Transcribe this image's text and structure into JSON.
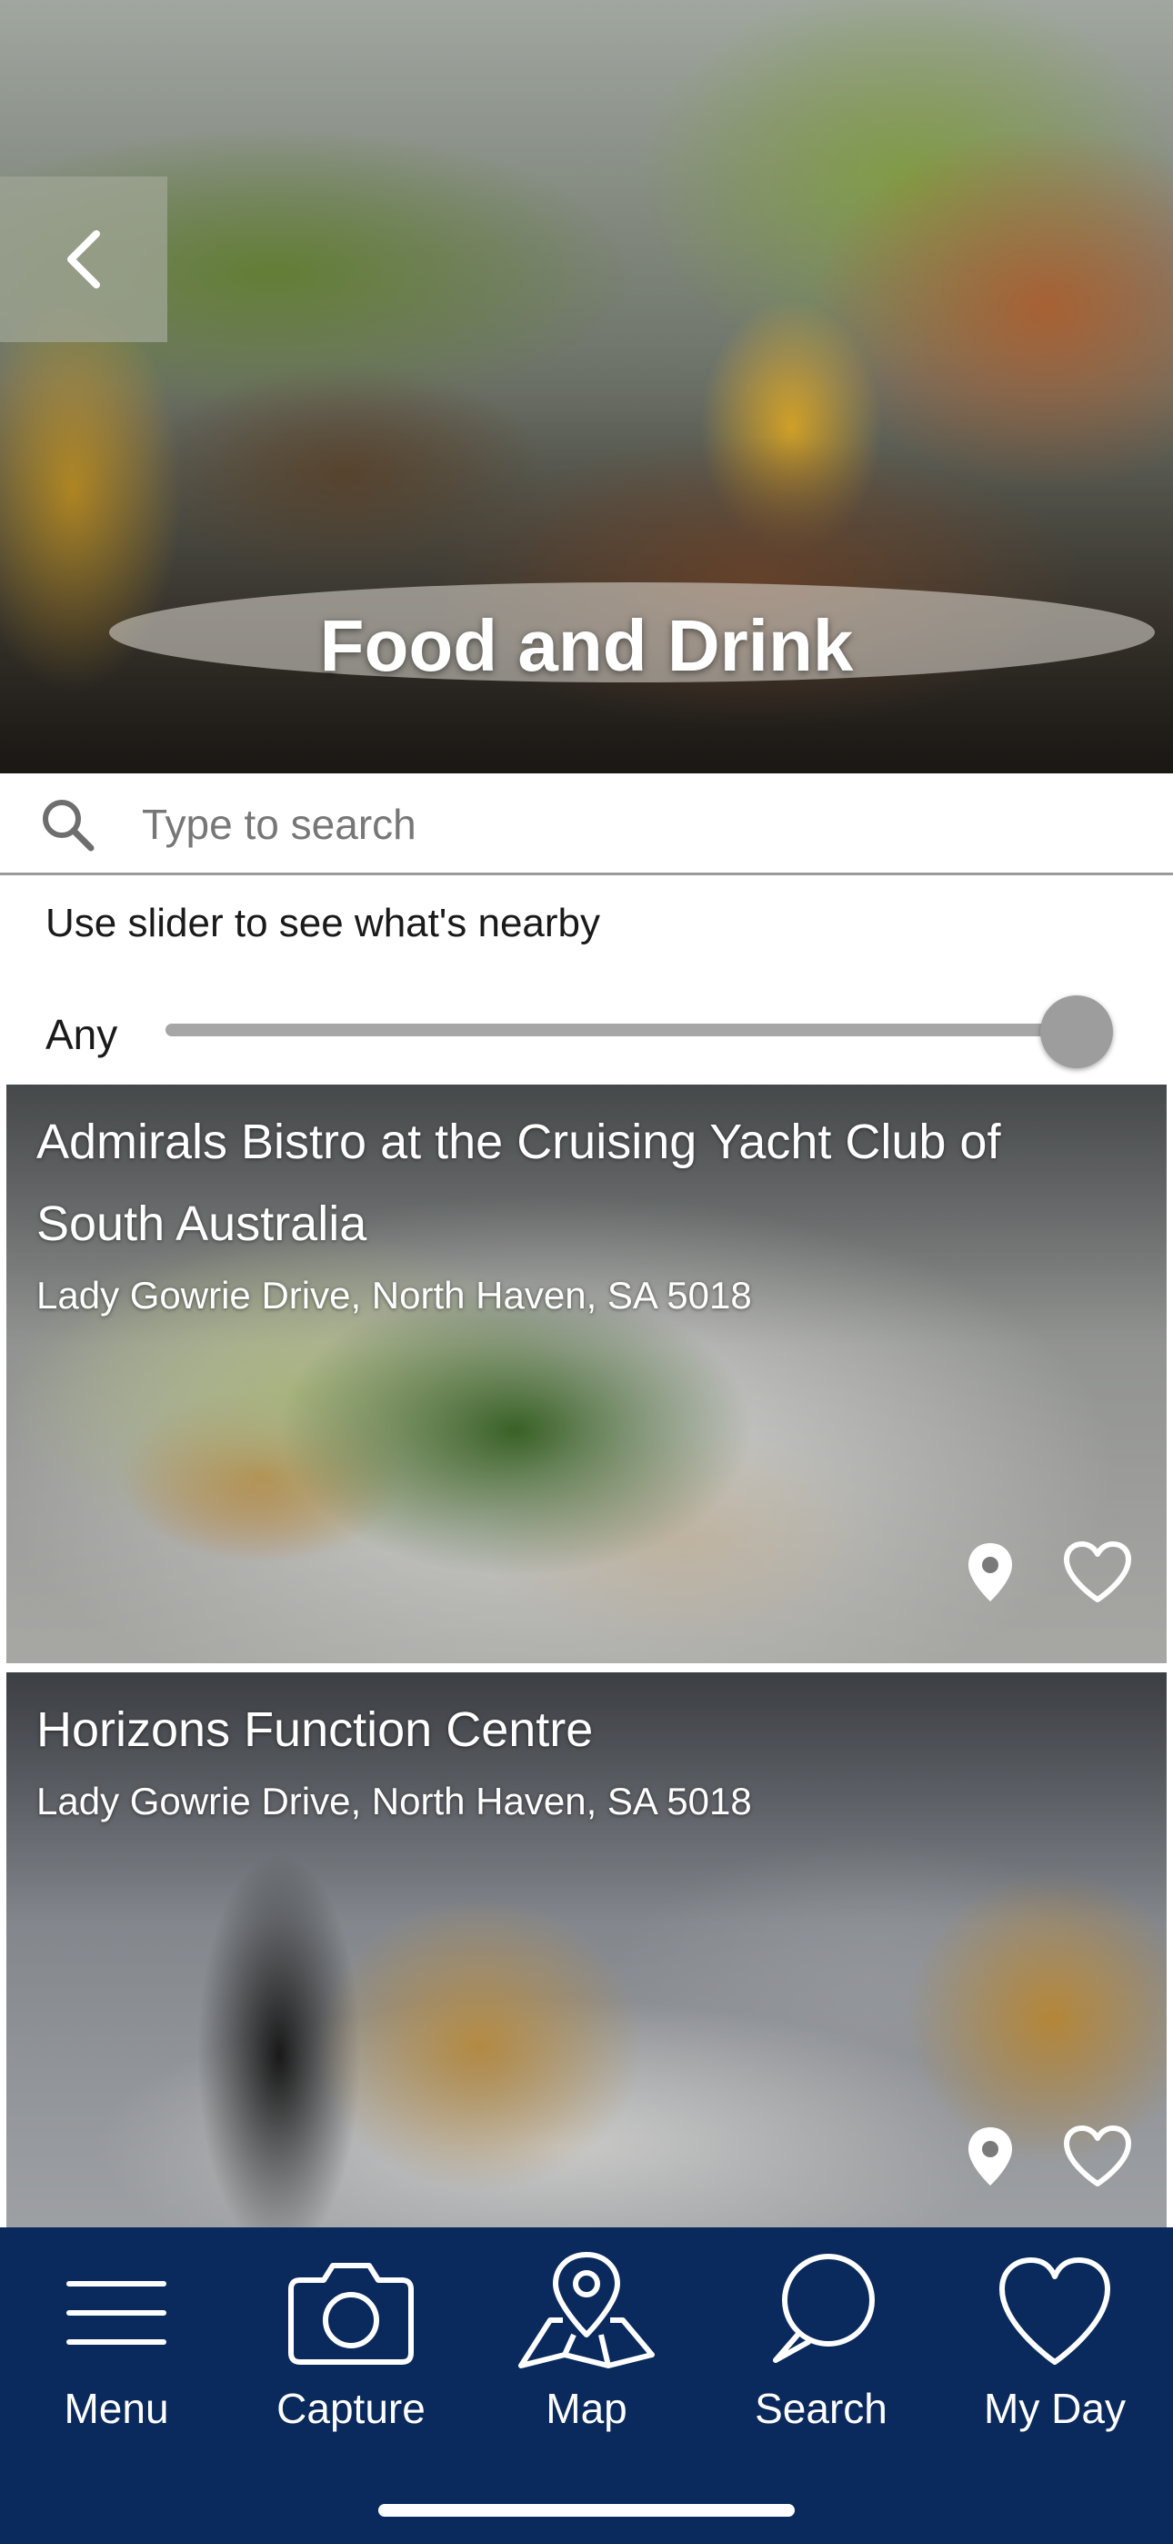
{
  "hero": {
    "title": "Food and Drink",
    "back_icon": "chevron-left-icon"
  },
  "search": {
    "placeholder": "Type to search",
    "value": "",
    "icon": "search-icon"
  },
  "nearby": {
    "hint": "Use slider to see what's nearby",
    "label": "Any",
    "slider_value_fraction": 1.0
  },
  "listings": [
    {
      "title": "Admirals Bistro at the Cruising Yacht Club of South Australia",
      "address": "Lady Gowrie Drive, North Haven, SA 5018"
    },
    {
      "title": "Horizons Function Centre",
      "address": "Lady Gowrie Drive, North Haven, SA 5018"
    }
  ],
  "nav": {
    "items": [
      {
        "label": "Menu",
        "icon": "menu-icon"
      },
      {
        "label": "Capture",
        "icon": "camera-icon"
      },
      {
        "label": "Map",
        "icon": "map-pin-icon"
      },
      {
        "label": "Search",
        "icon": "search-bubble-icon"
      },
      {
        "label": "My Day",
        "icon": "heart-icon"
      }
    ]
  },
  "colors": {
    "nav_background": "#0a2a5e",
    "slider": "#a6a6a6",
    "text": "#1a1a1a"
  }
}
